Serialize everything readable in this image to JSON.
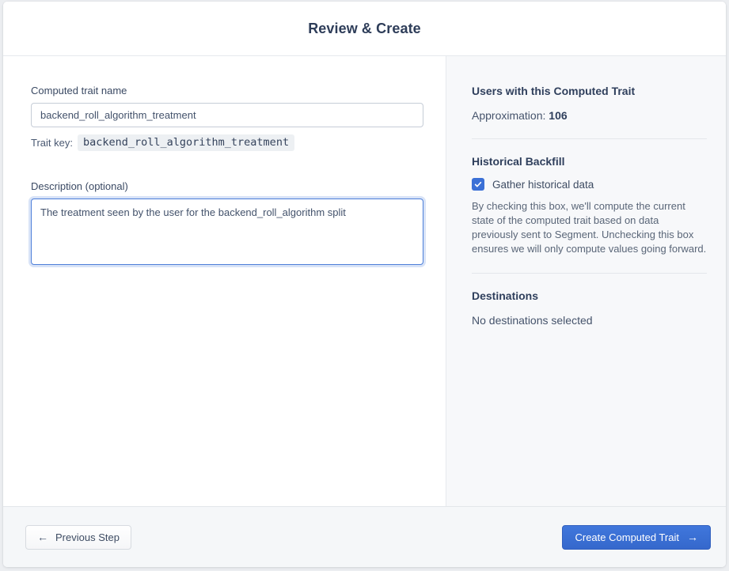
{
  "header": {
    "title": "Review & Create"
  },
  "form": {
    "name_label": "Computed trait name",
    "name_value": "backend_roll_algorithm_treatment",
    "trait_key_label": "Trait key:",
    "trait_key_value": "backend_roll_algorithm_treatment",
    "description_label": "Description (optional)",
    "description_value": "The treatment seen by the user for the backend_roll_algorithm split"
  },
  "sidebar": {
    "users_section": {
      "heading": "Users with this Computed Trait",
      "approximation_label": "Approximation: ",
      "approximation_value": "106"
    },
    "backfill_section": {
      "heading": "Historical Backfill",
      "checkbox_label": "Gather historical data",
      "checkbox_checked": true,
      "description": "By checking this box, we'll compute the current state of the computed trait based on data previously sent to Segment. Unchecking this box ensures we will only compute values going forward."
    },
    "destinations_section": {
      "heading": "Destinations",
      "empty_text": "No destinations selected"
    }
  },
  "footer": {
    "previous_label": "Previous Step",
    "previous_icon": "←",
    "create_label": "Create Computed Trait",
    "create_icon": "→"
  },
  "colors": {
    "accent_blue": "#3B70D6",
    "heading_navy": "#2F3F5C",
    "body_slate": "#45536B",
    "muted_gray": "#5A6678",
    "sidebar_bg": "#F7F8FA",
    "footer_bg": "#F5F7F9",
    "border": "#E6E9ED"
  }
}
